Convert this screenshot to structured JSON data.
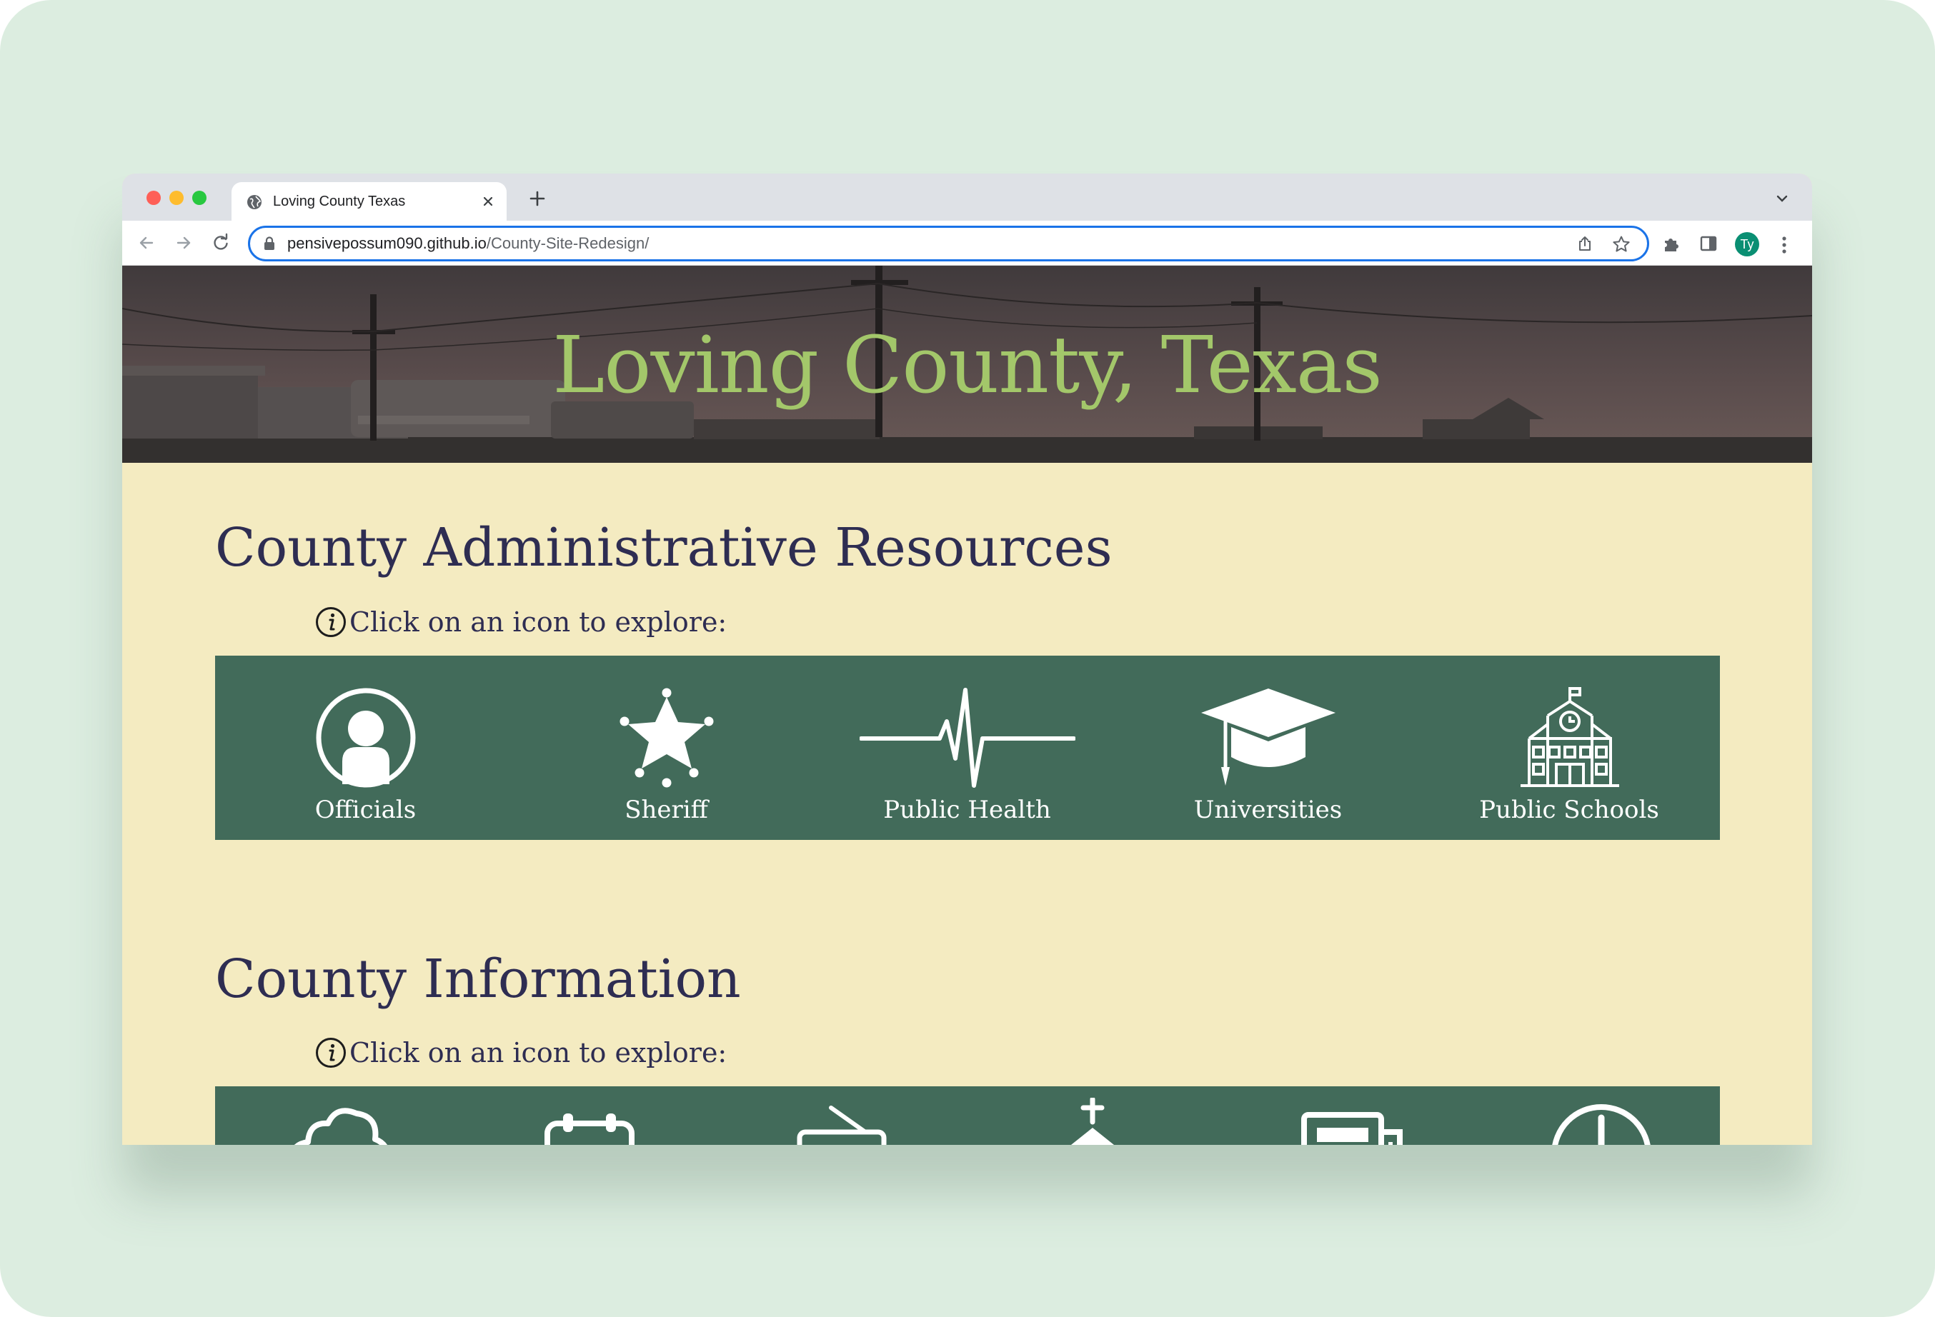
{
  "browser": {
    "tab_title": "Loving County Texas",
    "url_host": "pensivepossum090.github.io",
    "url_path": "/County-Site-Redesign/",
    "profile_initials": "Ty",
    "icons": [
      "globe-icon",
      "close-icon",
      "plus-icon",
      "chevron-down-icon",
      "back-arrow-icon",
      "forward-arrow-icon",
      "reload-icon",
      "lock-icon",
      "share-icon",
      "star-icon",
      "puzzle-icon",
      "side-panel-icon",
      "kebab-menu-icon"
    ]
  },
  "page": {
    "banner_title": "Loving County, Texas",
    "colors": {
      "banner_title": "#a3c76a",
      "heading": "#2e2d52",
      "page_background": "#f4ebc1",
      "icon_bar": "#426b5a"
    },
    "admin": {
      "heading": "County Administrative Resources",
      "hint": "Click on an icon to explore:",
      "items": [
        {
          "label": "Officials",
          "icon": "person-icon"
        },
        {
          "label": "Sheriff",
          "icon": "sheriff-star-icon"
        },
        {
          "label": "Public Health",
          "icon": "heartbeat-icon"
        },
        {
          "label": "Universities",
          "icon": "graduation-cap-icon"
        },
        {
          "label": "Public Schools",
          "icon": "school-building-icon"
        }
      ]
    },
    "info": {
      "heading": "County Information",
      "hint": "Click on an icon to explore:",
      "items": [
        {
          "icon": "cloud-icon"
        },
        {
          "icon": "calendar-icon"
        },
        {
          "icon": "radio-icon"
        },
        {
          "icon": "church-icon"
        },
        {
          "icon": "newspaper-icon"
        },
        {
          "icon": "clock-icon"
        }
      ]
    }
  }
}
